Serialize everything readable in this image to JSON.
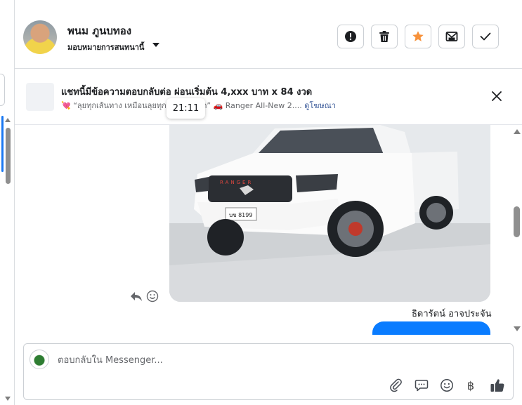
{
  "header": {
    "contact_name": "พนม ภูนบทอง",
    "assign_label": "มอบหมายการสนทนานี้"
  },
  "ad": {
    "title": "แชทนี้มีข้อความตอบกลับต่อ ผ่อนเริ่มต้น 4,xxx บาท x 84 งวด",
    "subtitle": "💘 “ลุยทุกเส้นทาง เหมือนลุยทุกเส้นทางชีวิต” 🚗 Ranger All-New 2....",
    "link_label": "ดูโฆษณา"
  },
  "tooltip": {
    "time": "21:11"
  },
  "conversation": {
    "sender_name": "ธิดารัตน์ อาจประจัน"
  },
  "composer": {
    "placeholder": "ตอบกลับใน Messenger...",
    "baht_symbol": "฿"
  },
  "colors": {
    "accent": "#1877f2",
    "bubble": "#0a7cff",
    "star": "#f7923b",
    "like": "#444950"
  }
}
